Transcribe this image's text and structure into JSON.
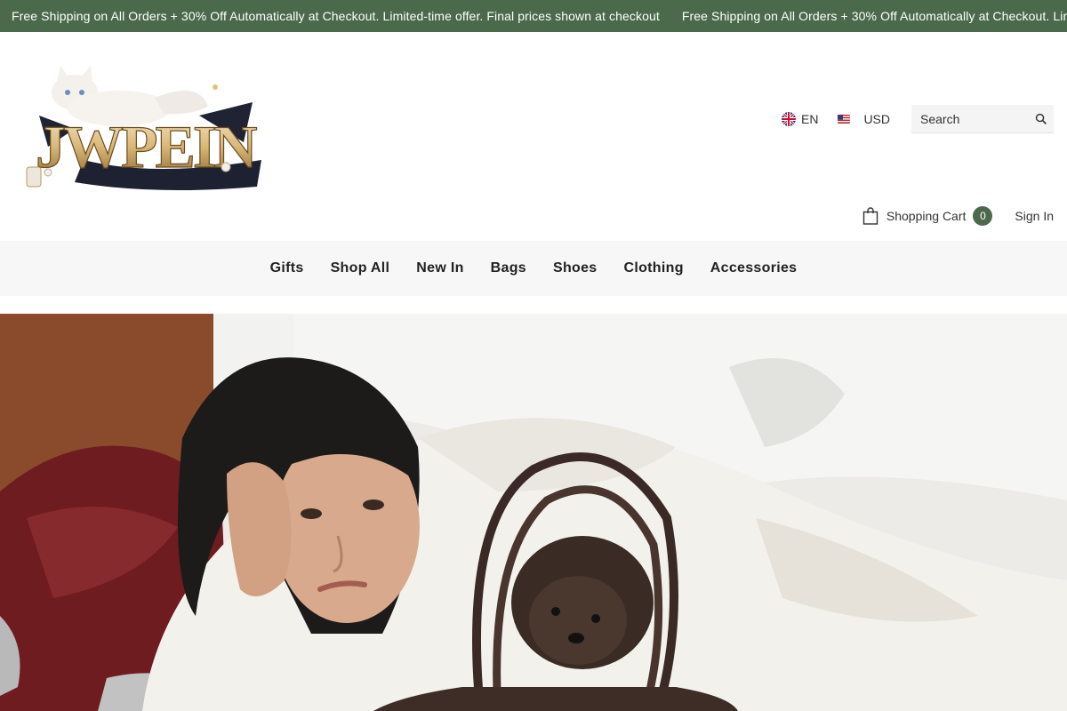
{
  "announcement": {
    "text": "Free Shipping on All Orders + 30% Off Automatically at Checkout. Limited-time offer. Final prices shown at checkout",
    "text_repeat": "Free Shipping on All Orders + 30% Off Automatically at Checkout. Limited-time offer. Final prices shown at checkout"
  },
  "logo": {
    "text": "JWPEIN"
  },
  "header": {
    "language": {
      "label": "EN",
      "icon": "uk-flag-icon"
    },
    "currency": {
      "label": "USD",
      "icon": "us-flag-icon"
    },
    "search": {
      "placeholder": "Search",
      "value": "",
      "icon": "search-icon"
    },
    "cart": {
      "label": "Shopping Cart",
      "count": "0",
      "icon": "shopping-bag-icon"
    },
    "signin": {
      "label": "Sign In"
    }
  },
  "nav": {
    "items": [
      {
        "label": "Gifts"
      },
      {
        "label": "Shop All"
      },
      {
        "label": "New In"
      },
      {
        "label": "Bags"
      },
      {
        "label": "Shoes"
      },
      {
        "label": "Clothing"
      },
      {
        "label": "Accessories"
      }
    ]
  },
  "colors": {
    "announcement_bg": "#4a6a4b",
    "cart_badge_bg": "#4a6a4b",
    "nav_bg": "#f7f7f7"
  }
}
